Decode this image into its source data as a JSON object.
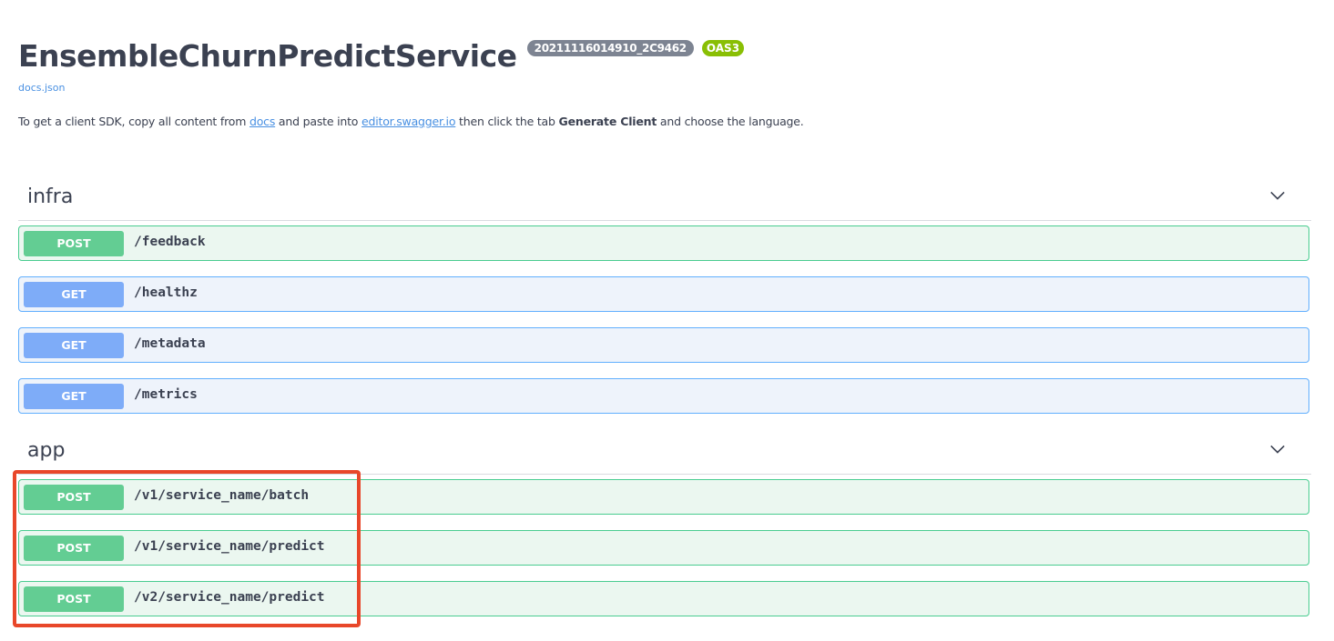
{
  "header": {
    "title": "EnsembleChurnPredictService",
    "version_badge": "20211116014910_2C9462",
    "oas_badge": "OAS3",
    "docs_link": "docs.json"
  },
  "description": {
    "part1": "To get a client SDK, copy all content from ",
    "link_docs": "docs",
    "part2": " and paste into ",
    "link_editor": "editor.swagger.io",
    "part3": " then click the tab ",
    "bold": "Generate Client",
    "part4": " and choose the language."
  },
  "tags": [
    {
      "name": "infra",
      "operations": [
        {
          "method": "POST",
          "path": "/feedback"
        },
        {
          "method": "GET",
          "path": "/healthz"
        },
        {
          "method": "GET",
          "path": "/metadata"
        },
        {
          "method": "GET",
          "path": "/metrics"
        }
      ]
    },
    {
      "name": "app",
      "operations": [
        {
          "method": "POST",
          "path": "/v1/service_name/batch"
        },
        {
          "method": "POST",
          "path": "/v1/service_name/predict"
        },
        {
          "method": "POST",
          "path": "/v2/service_name/predict"
        }
      ]
    }
  ],
  "colors": {
    "post_accent": "#49cc90",
    "get_accent": "#61affe",
    "highlight": "#e8472a"
  },
  "icons": {
    "collapse": "chevron-down-icon"
  }
}
